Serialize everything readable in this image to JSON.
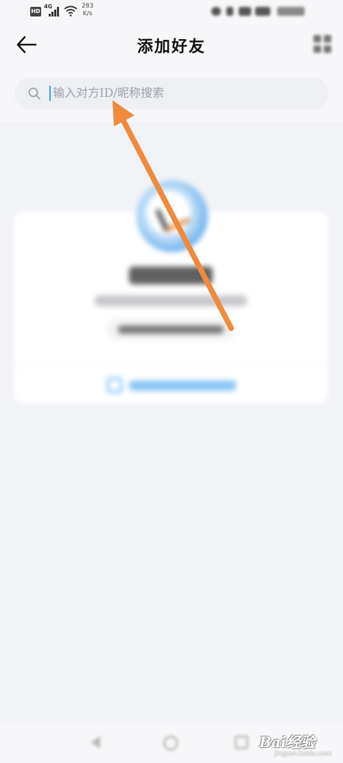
{
  "status_bar": {
    "hd": "HD",
    "network_type": "4G",
    "speed_value": "283",
    "speed_unit": "K/s"
  },
  "header": {
    "title": "添加好友",
    "back_icon": "arrow-left-icon",
    "action_icon": "scan-icon"
  },
  "search": {
    "placeholder": "输入对方ID/昵称搜索",
    "value": "",
    "icon": "search-icon"
  },
  "annotation": {
    "color": "#f08a3c"
  },
  "watermark": {
    "brand": "Bai经验",
    "url": "jingyan.baidu.com"
  },
  "colors": {
    "accent": "#2a9df4",
    "background": "#f2f3f7"
  }
}
